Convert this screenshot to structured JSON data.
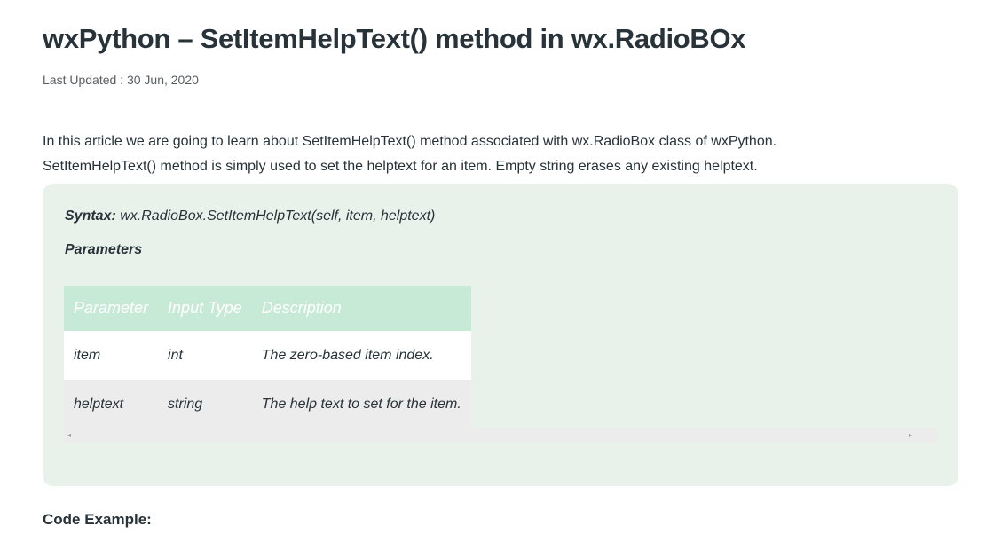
{
  "article": {
    "title": "wxPython – SetItemHelpText() method in wx.RadioBOx",
    "last_updated": "Last Updated : 30 Jun, 2020",
    "intro_line_1": "In this article we are going to learn about SetItemHelpText() method associated with wx.RadioBox class of wxPython.",
    "intro_line_2": "SetItemHelpText() method is simply used to set the helptext for an item. Empty string erases any existing helptext."
  },
  "syntax": {
    "label": "Syntax:",
    "signature": " wx.RadioBox.SetItemHelpText(self, item, helptext)",
    "parameters_heading": "Parameters"
  },
  "params_table": {
    "headers": [
      "Parameter",
      "Input Type",
      "Description"
    ],
    "rows": [
      [
        "item",
        "int",
        "The zero-based item index."
      ],
      [
        "helptext",
        "string",
        "The help text to set for the item."
      ]
    ]
  },
  "scrollbar": {
    "left_arrow_icon": "◂",
    "right_arrow_icon": "▸"
  },
  "code_example": {
    "heading": "Code Example:"
  },
  "colors": {
    "syntax_box_bg": "#e8f1ea",
    "table_header_bg": "#c7ead7",
    "text": "#273239"
  }
}
